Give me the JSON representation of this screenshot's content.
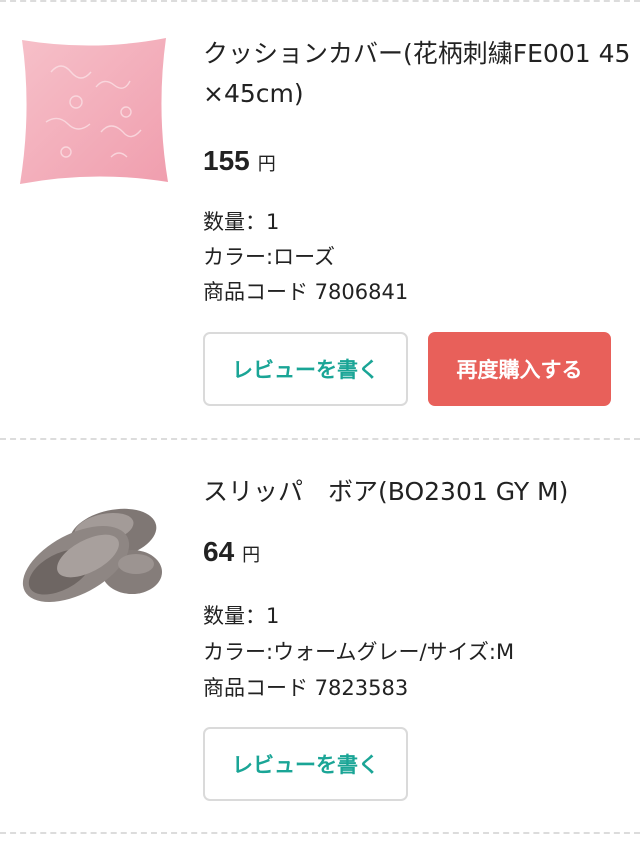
{
  "items": [
    {
      "title": "クッションカバー(花柄刺繍FE001 45×45cm)",
      "price": "155",
      "currency": "円",
      "quantity": "数量：1",
      "color": "カラー:ローズ",
      "code": "商品コード 7806841",
      "review_label": "レビューを書く",
      "rebuy_label": "再度購入する",
      "image_icon": "pink-cushion-image",
      "colors": {
        "image": "#f4b3be"
      }
    },
    {
      "title": "スリッパ　ボア(BO2301 GY M)",
      "price": "64",
      "currency": "円",
      "quantity": "数量：1",
      "color": "カラー:ウォームグレー/サイズ:M",
      "code": "商品コード 7823583",
      "review_label": "レビューを書く",
      "image_icon": "gray-slippers-image",
      "colors": {
        "image": "#8a8280"
      }
    }
  ],
  "colors": {
    "accent": "#1aa596",
    "rebuy": "#e8605a",
    "divider": "#dcdcdc"
  }
}
